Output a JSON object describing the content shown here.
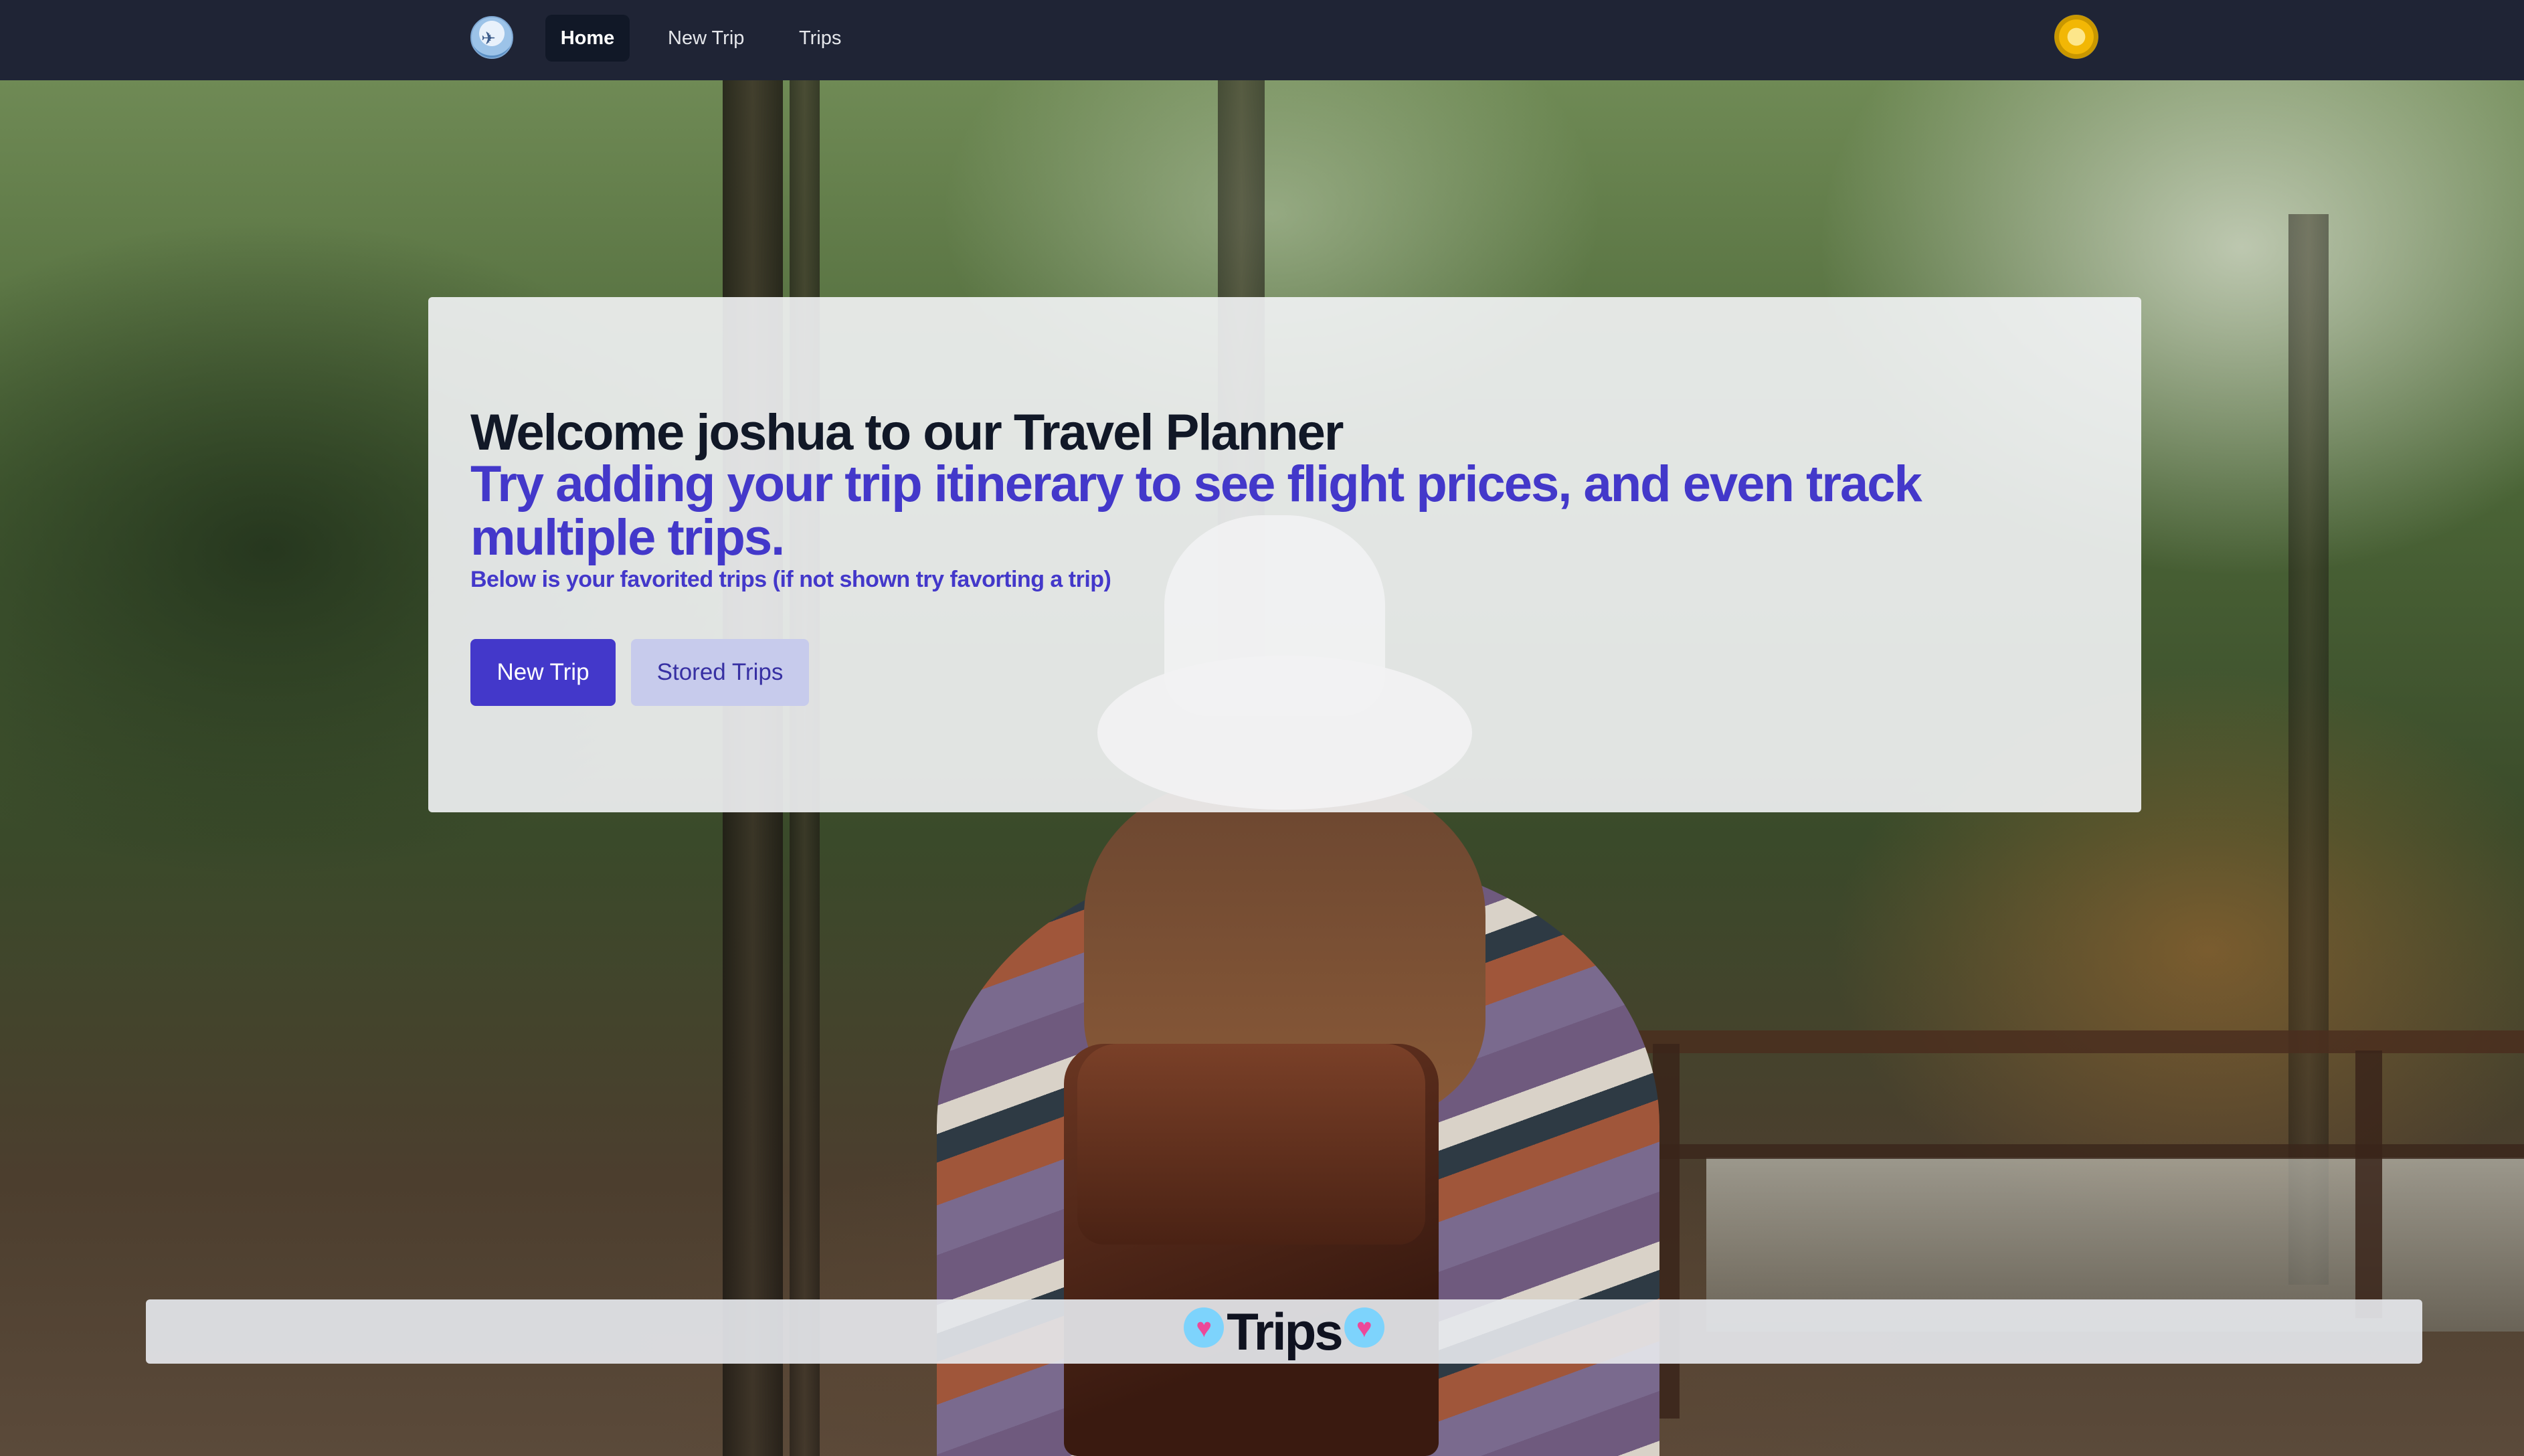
{
  "navbar": {
    "logo_icon": "plane-logo-icon",
    "items": [
      {
        "label": "Home",
        "active": true
      },
      {
        "label": "New Trip",
        "active": false
      },
      {
        "label": "Trips",
        "active": false
      }
    ],
    "avatar_icon": "user-avatar-icon",
    "background_color": "#1f2435"
  },
  "hero": {
    "title": "Welcome joshua to our Travel Planner",
    "subtitle": "Try adding your trip itinerary to see flight prices, and even track multiple trips.",
    "note": "Below is your favorited trips (if not shown try favorting a trip)",
    "primary_button": "New Trip",
    "secondary_button": "Stored Trips",
    "accent_color": "#4338ca"
  },
  "trips_section": {
    "heading": "Trips",
    "left_icon": "heart-icon",
    "right_icon": "heart-icon",
    "heart_glyph": "♥"
  }
}
